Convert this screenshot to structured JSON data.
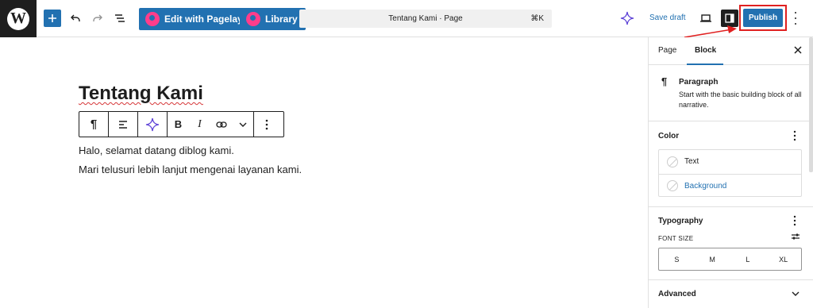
{
  "topbar": {
    "wp_logo": "W",
    "pagelayer_button": "Edit with Pagelayer",
    "library_button": "Library",
    "command_title": "Tentang Kami · Page",
    "command_shortcut": "⌘K",
    "save_draft": "Save draft",
    "publish": "Publish"
  },
  "editor": {
    "title": "Tentang Kami",
    "paragraphs": [
      "Halo, selamat datang diblog kami.",
      "Mari telusuri lebih lanjut mengenai layanan kami."
    ]
  },
  "sidebar": {
    "tabs": [
      "Page",
      "Block"
    ],
    "active_tab": "Block",
    "block_name": "Paragraph",
    "block_description": "Start with the basic building block of all narrative.",
    "color_title": "Color",
    "color_items": [
      "Text",
      "Background"
    ],
    "typography_title": "Typography",
    "font_size_label": "FONT SIZE",
    "font_sizes": [
      "S",
      "M",
      "L",
      "XL"
    ],
    "advanced_title": "Advanced"
  },
  "colors": {
    "accent": "#2271b1",
    "dark": "#1e1e1e",
    "highlight": "#e02020"
  }
}
